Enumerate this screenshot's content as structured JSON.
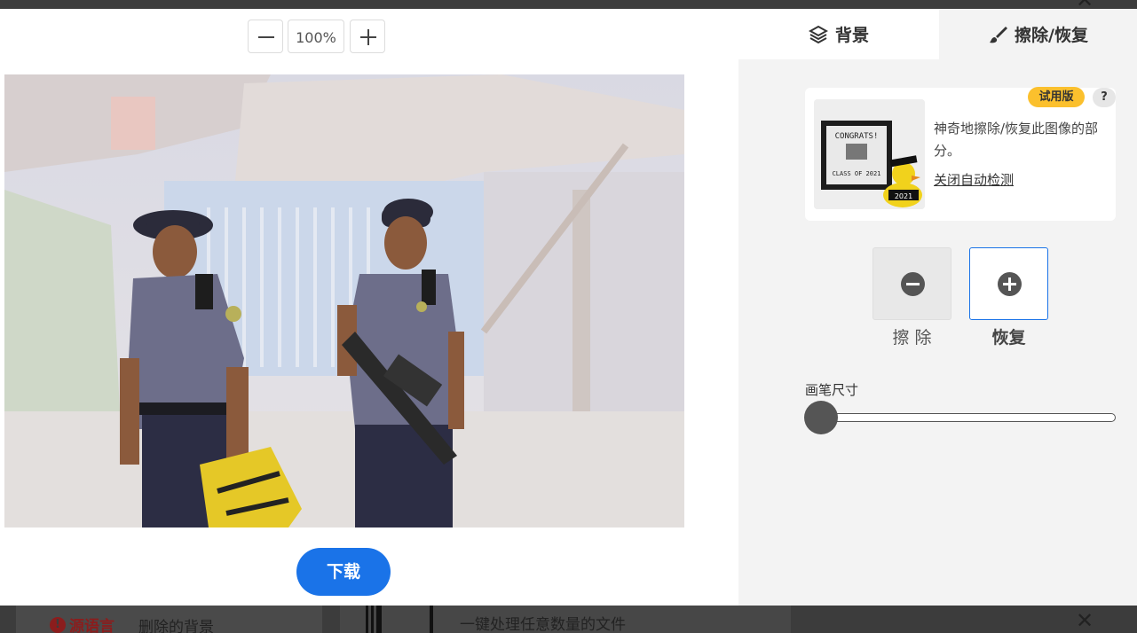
{
  "toolbar": {
    "zoom_value": "100%",
    "zoom_out_icon": "minus-icon",
    "zoom_in_icon": "plus-icon"
  },
  "tabs": [
    {
      "label": "背景",
      "icon": "layers-icon"
    },
    {
      "label": "擦除/恢复",
      "icon": "brush-icon",
      "active": true
    }
  ],
  "info_card": {
    "badge": "试用版",
    "help": "?",
    "description": "神奇地擦除/恢复此图像的部分。",
    "link": "关闭自动检测",
    "thumbnail_text": {
      "line1": "CONGRATS!",
      "line2": "CLASS OF 2021",
      "duck_tag": "2021"
    }
  },
  "modes": {
    "erase_label": "擦 除",
    "restore_label": "恢复",
    "selected": "restore"
  },
  "brush": {
    "label": "画笔尺寸",
    "level": 0
  },
  "download_label": "下载",
  "background_page": {
    "warning_text": "源语言",
    "removed_text": "删除的背景",
    "batch_text": "一键处理任意数量的文件",
    "close_icon": "close-icon"
  },
  "colors": {
    "accent": "#1a73e8",
    "badge": "#fbc02d",
    "panel": "#f3f3f3"
  }
}
